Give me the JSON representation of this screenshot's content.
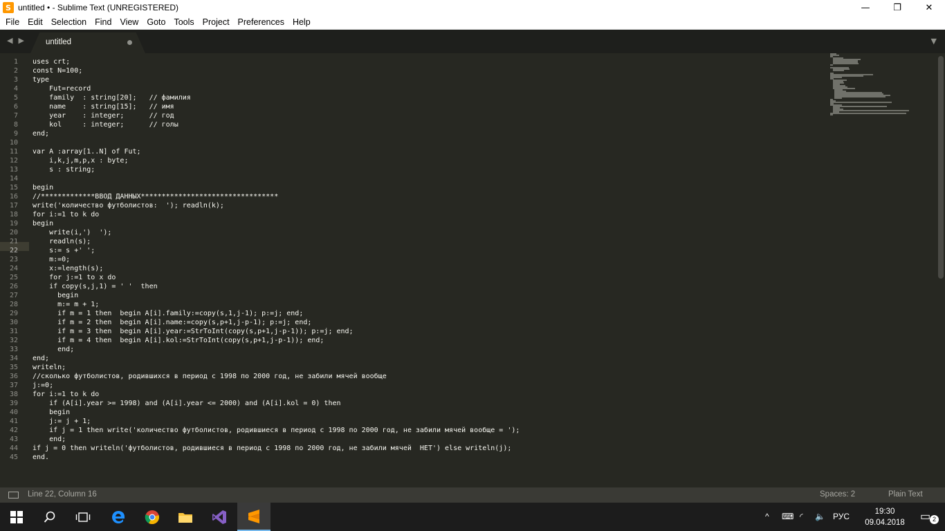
{
  "window": {
    "title": "untitled • - Sublime Text (UNREGISTERED)",
    "app_icon_glyph": "S",
    "minimize": "—",
    "maximize": "❐",
    "close": "✕"
  },
  "menu": [
    "File",
    "Edit",
    "Selection",
    "Find",
    "View",
    "Goto",
    "Tools",
    "Project",
    "Preferences",
    "Help"
  ],
  "tabs": [
    {
      "label": "untitled",
      "dirty": true
    }
  ],
  "editor": {
    "active_line": 22,
    "lines": [
      "uses crt;",
      "const N=100;",
      "type",
      "    Fut=record",
      "    family  : string[20];   // фамилия",
      "    name    : string[15];   // имя",
      "    year    : integer;      // год",
      "    kol     : integer;      // голы",
      "end;",
      "",
      "var A :array[1..N] of Fut;",
      "    i,k,j,m,p,x : byte;",
      "    s : string;",
      "",
      "begin",
      "//*************ВВОД ДАННЫХ*********************************",
      "write('количество футболистов:  '); readln(k);",
      "for i:=1 to k do",
      "begin",
      "    write(i,')  ');",
      "    readln(s);",
      "    s:= s +' ';",
      "    m:=0;",
      "    x:=length(s);",
      "    for j:=1 to x do",
      "    if copy(s,j,1) = ' '  then",
      "      begin",
      "      m:= m + 1;",
      "      if m = 1 then  begin A[i].family:=copy(s,1,j-1); p:=j; end;",
      "      if m = 2 then  begin A[i].name:=copy(s,p+1,j-p-1); p:=j; end;",
      "      if m = 3 then  begin A[i].year:=StrToInt(copy(s,p+1,j-p-1)); p:=j; end;",
      "      if m = 4 then  begin A[i].kol:=StrToInt(copy(s,p+1,j-p-1)); end;",
      "      end;",
      "end;",
      "writeln;",
      "//сколько футболистов, родившихся в период с 1998 по 2000 год, не забили мячей вообще",
      "j:=0;",
      "for i:=1 to k do",
      "    if (A[i].year >= 1998) and (A[i].year <= 2000) and (A[i].kol = 0) then",
      "    begin",
      "    j:= j + 1;",
      "    if j = 1 then write('количество футболистов, родившиеся в период с 1998 по 2000 год, не забили мячей вообще = ');",
      "    end;",
      "if j = 0 then writeln('футболистов, родившиеся в период с 1998 по 2000 год, не забили мячей  НЕТ') else writeln(j);",
      "end."
    ]
  },
  "status": {
    "position": "Line 22, Column 16",
    "indent": "Spaces: 2",
    "syntax": "Plain Text"
  },
  "taskbar": {
    "language": "РУС",
    "time": "19:30",
    "date": "09.04.2018",
    "notifications": "2"
  }
}
